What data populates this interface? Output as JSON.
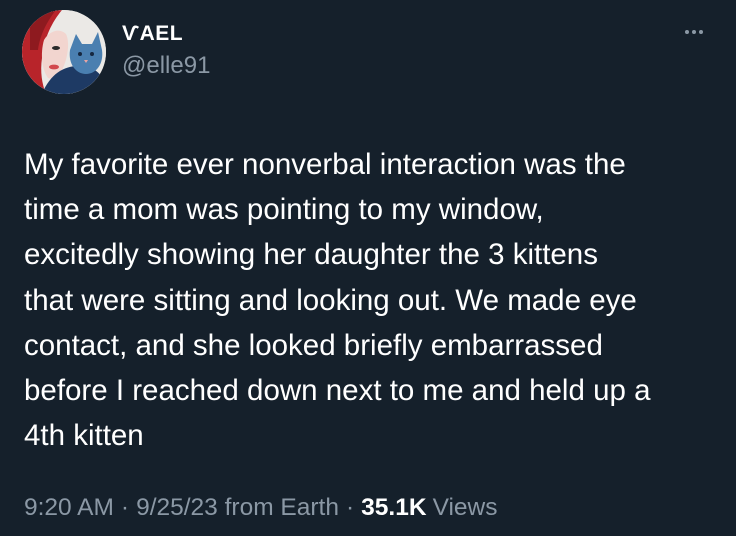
{
  "author": {
    "display_name": "ѴAEL",
    "handle": "@elle91",
    "avatar_icon": "illustrated-woman-with-cat-avatar"
  },
  "more_icon": "ellipsis-icon",
  "tweet": {
    "text": "My favorite ever nonverbal interaction was the\ntime a mom was pointing to my window,\nexcitedly showing her daughter the 3 kittens\nthat were sitting and looking out. We made eye\ncontact, and she looked briefly embarrassed\nbefore I reached down next to me and held up a\n4th kitten"
  },
  "meta": {
    "time": "9:20 AM",
    "separator": "·",
    "date": "9/25/23",
    "source": "from Earth",
    "views_count": "35.1K",
    "views_label": "Views"
  },
  "colors": {
    "background": "#15202b",
    "primary_text": "#ffffff",
    "secondary_text": "#8b98a5"
  }
}
